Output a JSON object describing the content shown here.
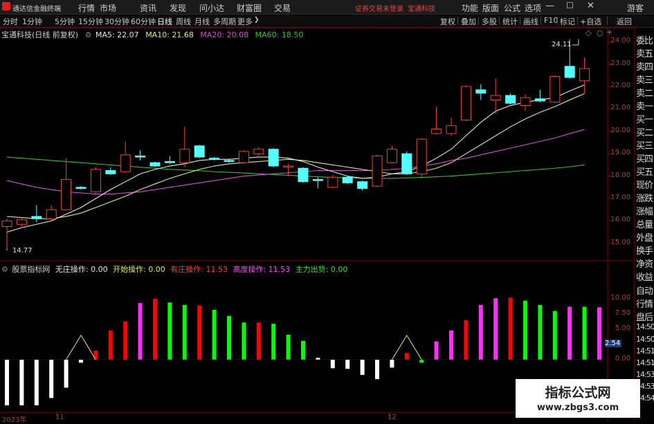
{
  "menubar": {
    "app_title": "通达信金融终端",
    "menus": [
      "行情",
      "市场",
      "资讯",
      "发现",
      "问小达",
      "财富圈",
      "交易"
    ],
    "notice": "证券交易未登录",
    "broker": "宝通科技",
    "right_menus": [
      "功能",
      "版面",
      "公式",
      "选项"
    ],
    "user": "游客"
  },
  "tabs": [
    "分时",
    "1分钟",
    "5分钟",
    "15分钟",
    "30分钟",
    "60分钟",
    "日线",
    "周线",
    "月线",
    "多周期",
    "更多"
  ],
  "active_tab": "日线",
  "toolbar": [
    "复权",
    "叠加",
    "多股",
    "统计",
    "画线",
    "F10",
    "标记",
    "+自选",
    "返回"
  ],
  "main_legend": {
    "title": "宝通科技(日线 前复权)",
    "ma5": "MA5: 22.07",
    "ma10": "MA10: 21.68",
    "ma20": "MA20: 20.08",
    "ma60": "MA60: 18.50"
  },
  "price_axis": [
    "24.00",
    "23.00",
    "22.00",
    "21.00",
    "20.00",
    "19.00",
    "18.00",
    "17.00",
    "16.00",
    "15.00"
  ],
  "annotations": {
    "high": "24.11",
    "low": "14.77"
  },
  "sub_legend": {
    "name": "股票指标网",
    "wz": "无庄操作: 0.00",
    "ks": "开始操作: 0.00",
    "yz": "有庄操作: 11.53",
    "gd": "高度操作: 11.53",
    "zl": "主力出货: 0.00"
  },
  "sub_axis": [
    "10.00",
    "7.50",
    "5.00",
    "2.54",
    "0.00"
  ],
  "time_axis": [
    "2023年",
    "11",
    "12"
  ],
  "right_panel": [
    "委比",
    "卖五",
    "卖四",
    "卖三",
    "卖二",
    "卖一",
    "买一",
    "买二",
    "买三",
    "买四",
    "买五",
    "现价",
    "涨跌",
    "涨幅",
    "总量",
    "外盘",
    "换手",
    "净资",
    "收益",
    "自动",
    "行情",
    "盘后",
    "14:50",
    "14:50",
    "14:51",
    "14:51",
    "14:53",
    "14:53",
    "14:54"
  ],
  "watermark": {
    "line1": "指标公式网",
    "line2": "www.zbgs3.com"
  },
  "colors": {
    "up": "#ff3b3b",
    "down": "#54ffff",
    "ma5": "#e8e8e8",
    "ma10": "#e8e878",
    "ma20": "#d050d0",
    "ma60": "#30c030",
    "bar_green": "#00ff00",
    "bar_magenta": "#ff30ff",
    "bar_red": "#ff0000",
    "bar_white": "#ffffff"
  },
  "chart_data": {
    "type": "candlestick",
    "candles": [
      {
        "o": 15.75,
        "c": 16.0,
        "h": 16.1,
        "l": 14.77
      },
      {
        "o": 15.85,
        "c": 16.05,
        "h": 16.15,
        "l": 15.75
      },
      {
        "o": 16.2,
        "c": 16.1,
        "h": 16.7,
        "l": 15.95
      },
      {
        "o": 16.1,
        "c": 16.5,
        "h": 16.7,
        "l": 16.0
      },
      {
        "o": 16.5,
        "c": 17.85,
        "h": 18.8,
        "l": 16.45
      },
      {
        "o": 17.5,
        "c": 17.45,
        "h": 17.55,
        "l": 17.4
      },
      {
        "o": 17.3,
        "c": 18.3,
        "h": 18.4,
        "l": 17.25
      },
      {
        "o": 18.25,
        "c": 18.1,
        "h": 18.4,
        "l": 18.05
      },
      {
        "o": 18.2,
        "c": 18.95,
        "h": 19.55,
        "l": 18.15
      },
      {
        "o": 18.9,
        "c": 18.85,
        "h": 19.15,
        "l": 18.7
      },
      {
        "o": 18.6,
        "c": 18.45,
        "h": 18.65,
        "l": 18.4
      },
      {
        "o": 18.65,
        "c": 18.6,
        "h": 18.9,
        "l": 18.55
      },
      {
        "o": 18.6,
        "c": 19.2,
        "h": 20.2,
        "l": 18.4
      },
      {
        "o": 19.35,
        "c": 18.85,
        "h": 19.4,
        "l": 18.8
      },
      {
        "o": 18.8,
        "c": 18.75,
        "h": 18.85,
        "l": 18.7
      },
      {
        "o": 18.7,
        "c": 18.65,
        "h": 18.75,
        "l": 18.6
      },
      {
        "o": 18.6,
        "c": 19.1,
        "h": 19.15,
        "l": 18.55
      },
      {
        "o": 19.0,
        "c": 19.2,
        "h": 19.3,
        "l": 18.9
      },
      {
        "o": 19.2,
        "c": 18.45,
        "h": 19.25,
        "l": 18.4
      },
      {
        "o": 18.4,
        "c": 18.45,
        "h": 18.55,
        "l": 18.0
      },
      {
        "o": 18.35,
        "c": 17.75,
        "h": 18.4,
        "l": 17.7
      },
      {
        "o": 17.85,
        "c": 17.8,
        "h": 17.95,
        "l": 17.45
      },
      {
        "o": 17.5,
        "c": 17.95,
        "h": 18.05,
        "l": 17.45
      },
      {
        "o": 17.95,
        "c": 17.7,
        "h": 18.0,
        "l": 17.65
      },
      {
        "o": 17.75,
        "c": 17.45,
        "h": 17.8,
        "l": 17.35
      },
      {
        "o": 17.55,
        "c": 18.9,
        "h": 18.95,
        "l": 17.5
      },
      {
        "o": 18.6,
        "c": 19.2,
        "h": 19.35,
        "l": 18.55
      },
      {
        "o": 19.0,
        "c": 18.1,
        "h": 19.1,
        "l": 18.05
      },
      {
        "o": 18.1,
        "c": 19.65,
        "h": 19.7,
        "l": 17.9
      },
      {
        "o": 19.9,
        "c": 20.1,
        "h": 21.1,
        "l": 19.85
      },
      {
        "o": 19.9,
        "c": 20.25,
        "h": 20.6,
        "l": 19.8
      },
      {
        "o": 20.5,
        "c": 22.0,
        "h": 22.05,
        "l": 20.45
      },
      {
        "o": 21.85,
        "c": 21.7,
        "h": 22.1,
        "l": 21.4
      },
      {
        "o": 21.4,
        "c": 21.6,
        "h": 22.35,
        "l": 20.8
      },
      {
        "o": 21.6,
        "c": 21.25,
        "h": 21.7,
        "l": 21.2
      },
      {
        "o": 21.15,
        "c": 21.5,
        "h": 21.65,
        "l": 20.9
      },
      {
        "o": 21.45,
        "c": 21.35,
        "h": 21.85,
        "l": 21.3
      },
      {
        "o": 21.3,
        "c": 22.45,
        "h": 22.5,
        "l": 21.25
      },
      {
        "o": 22.9,
        "c": 22.4,
        "h": 24.11,
        "l": 22.35
      },
      {
        "o": 22.25,
        "c": 22.8,
        "h": 23.3,
        "l": 21.7
      }
    ],
    "ma5": [
      15.5,
      15.7,
      15.85,
      16.0,
      16.3,
      16.6,
      17.0,
      17.4,
      17.75,
      18.1,
      18.3,
      18.45,
      18.55,
      18.7,
      18.75,
      18.75,
      18.8,
      18.85,
      18.85,
      18.8,
      18.65,
      18.4,
      18.2,
      18.0,
      17.9,
      17.95,
      18.1,
      18.2,
      18.45,
      18.8,
      19.2,
      19.8,
      20.4,
      20.9,
      21.15,
      21.3,
      21.4,
      21.5,
      21.8,
      22.07
    ],
    "ma10": [
      16.2,
      16.15,
      16.1,
      16.1,
      16.2,
      16.35,
      16.6,
      16.85,
      17.1,
      17.4,
      17.65,
      17.9,
      18.1,
      18.3,
      18.45,
      18.55,
      18.6,
      18.65,
      18.7,
      18.75,
      18.7,
      18.6,
      18.5,
      18.4,
      18.3,
      18.2,
      18.1,
      18.1,
      18.2,
      18.35,
      18.6,
      19.0,
      19.4,
      19.8,
      20.2,
      20.55,
      20.85,
      21.1,
      21.4,
      21.68
    ],
    "ma20": [
      17.8,
      17.65,
      17.5,
      17.4,
      17.3,
      17.25,
      17.2,
      17.2,
      17.25,
      17.3,
      17.4,
      17.5,
      17.6,
      17.7,
      17.8,
      17.9,
      18.0,
      18.05,
      18.1,
      18.15,
      18.2,
      18.25,
      18.25,
      18.25,
      18.25,
      18.25,
      18.3,
      18.35,
      18.45,
      18.55,
      18.7,
      18.8,
      18.95,
      19.1,
      19.25,
      19.4,
      19.55,
      19.7,
      19.9,
      20.08
    ],
    "ma60": [
      18.85,
      18.8,
      18.75,
      18.7,
      18.65,
      18.6,
      18.55,
      18.5,
      18.45,
      18.4,
      18.35,
      18.3,
      18.27,
      18.24,
      18.2,
      18.17,
      18.14,
      18.1,
      18.07,
      18.04,
      18.0,
      17.97,
      17.94,
      17.92,
      17.9,
      17.9,
      17.9,
      17.92,
      17.94,
      17.97,
      18.0,
      18.05,
      18.1,
      18.15,
      18.2,
      18.25,
      18.3,
      18.35,
      18.42,
      18.5
    ],
    "indicator": {
      "values": [
        -7.5,
        -7.5,
        -7.5,
        -6.3,
        -4.6,
        -0.5,
        1.5,
        4.8,
        6.3,
        9.3,
        10.0,
        9.4,
        9.0,
        8.9,
        8.2,
        7.2,
        6.1,
        6.1,
        5.9,
        4.1,
        3.1,
        0.3,
        -1.4,
        -1.5,
        -2.5,
        -3.2,
        -1.3,
        1.1,
        -0.5,
        3.0,
        4.8,
        6.5,
        9.0,
        10.1,
        10.2,
        9.7,
        9.0,
        8.0,
        8.7,
        8.7,
        8.6
      ],
      "colors": [
        "w",
        "w",
        "w",
        "w",
        "w",
        "w",
        "r",
        "r",
        "r",
        "m",
        "r",
        "g",
        "g",
        "r",
        "g",
        "g",
        "g",
        "r",
        "g",
        "g",
        "g",
        "w",
        "w",
        "w",
        "w",
        "w",
        "w",
        "r",
        "g",
        "m",
        "m",
        "r",
        "m",
        "m",
        "r",
        "g",
        "g",
        "g",
        "m",
        "g",
        "m"
      ],
      "triangles": [
        {
          "peak": 4.0
        },
        {
          "peak": 4.0
        }
      ],
      "ylim": [
        -8,
        11
      ]
    }
  }
}
